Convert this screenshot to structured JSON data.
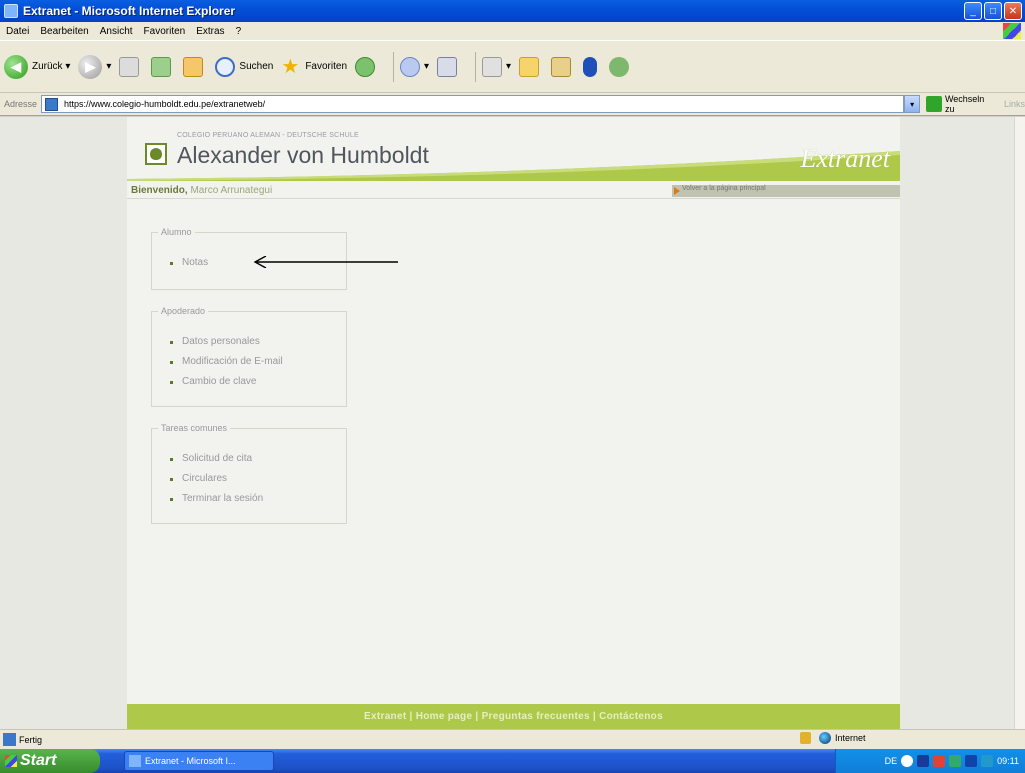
{
  "window": {
    "title": "Extranet - Microsoft Internet Explorer"
  },
  "menu": [
    "Datei",
    "Bearbeiten",
    "Ansicht",
    "Favoriten",
    "Extras",
    "?"
  ],
  "toolbar": {
    "back": "Zurück",
    "search": "Suchen",
    "favorites": "Favoriten"
  },
  "address": {
    "label": "Adresse",
    "url": "https://www.colegio-humboldt.edu.pe/extranetweb/",
    "go": "Wechseln zu",
    "links": "Links"
  },
  "page": {
    "school_top": "COLEGIO PERUANO ALEMAN - DEUTSCHE SCHULE",
    "school_name": "Alexander von Humboldt",
    "brand": "Extranet",
    "welcome_prefix": "Bienvenido,",
    "welcome_name": "Marco Arrunategui",
    "back_link": "Volver a la página principal",
    "boxes": [
      {
        "title": "Alumno",
        "items": [
          "Notas"
        ]
      },
      {
        "title": "Apoderado",
        "items": [
          "Datos personales",
          "Modificación de E-mail",
          "Cambio de clave"
        ]
      },
      {
        "title": "Tareas comunes",
        "items": [
          "Solicitud de cita",
          "Circulares",
          "Terminar la sesión"
        ]
      }
    ],
    "footer": "Extranet | Home page | Preguntas frecuentes | Contáctenos"
  },
  "status": {
    "text": "Fertig",
    "zone": "Internet"
  },
  "taskbar": {
    "start": "Start",
    "task": "Extranet - Microsoft I...",
    "lang": "DE",
    "time": "09:11"
  },
  "colors": {
    "accent_green": "#aec84a",
    "xp_blue": "#245edb"
  }
}
